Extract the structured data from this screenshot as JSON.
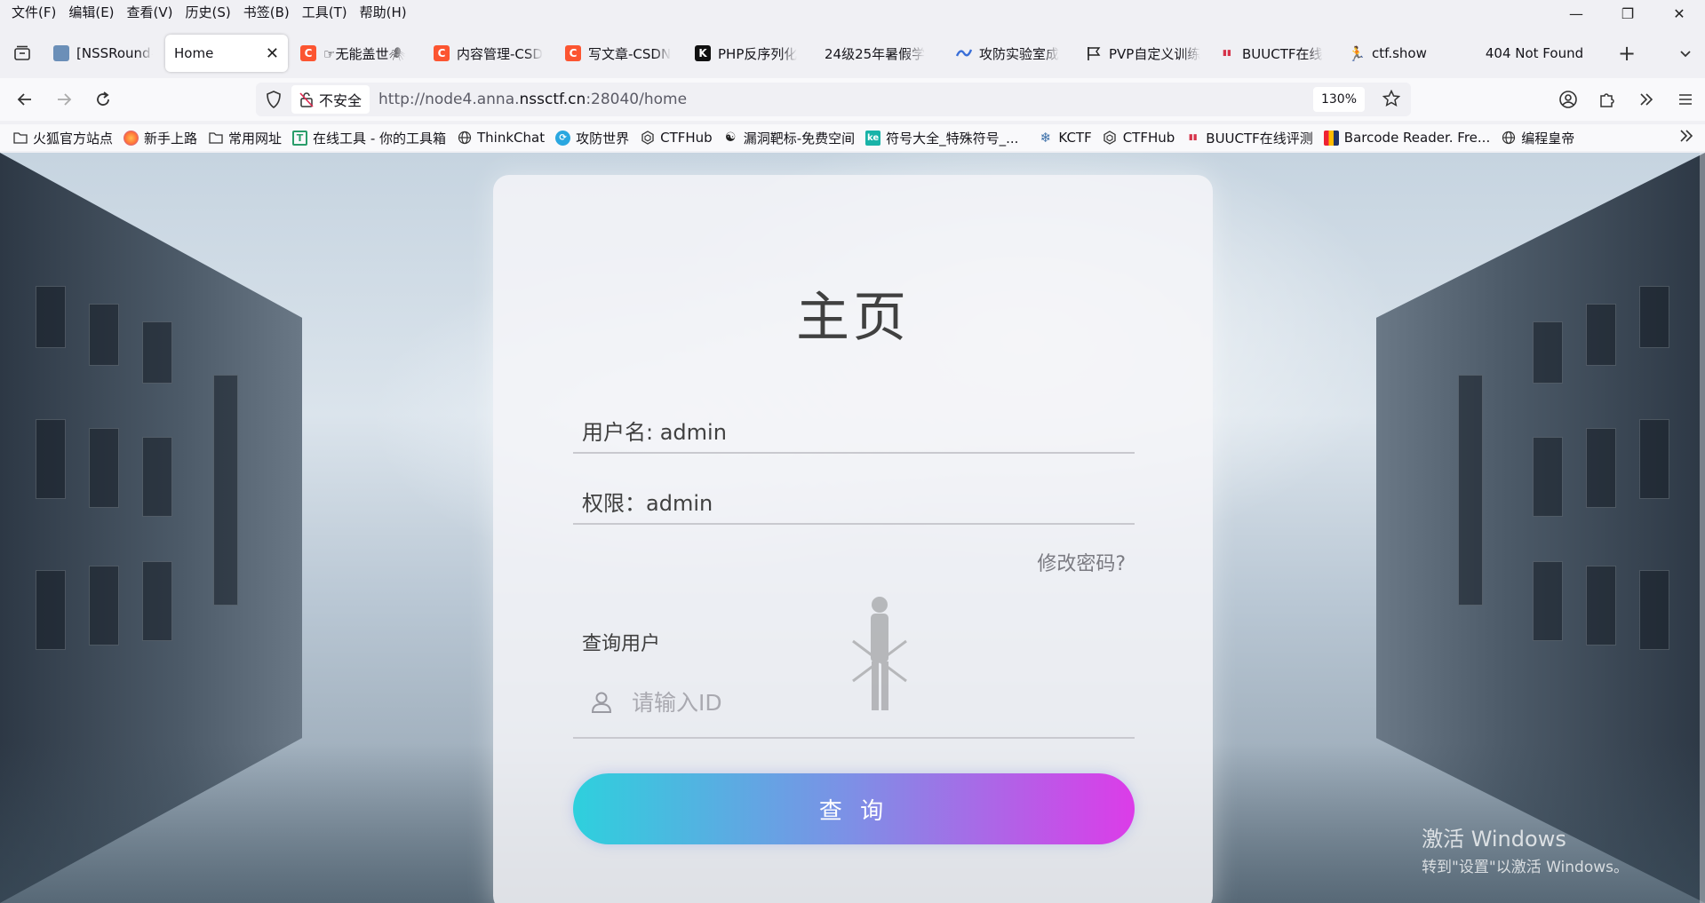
{
  "menu": [
    "文件(F)",
    "编辑(E)",
    "查看(V)",
    "历史(S)",
    "书签(B)",
    "工具(T)",
    "帮助(H)"
  ],
  "window_controls": {
    "minimize": "—",
    "restore": "❐",
    "close": "✕"
  },
  "tabs": [
    {
      "label": "[NSSRound#",
      "icon": "nss-icon",
      "color": "#6b8fb8",
      "glyph": ""
    },
    {
      "label": "Home",
      "icon": "page-icon",
      "active": true
    },
    {
      "label": "☞无能盖世🕷",
      "icon": "csdn-icon",
      "color": "#fc5531",
      "glyph": "C"
    },
    {
      "label": "内容管理-CSD",
      "icon": "csdn-icon",
      "color": "#fc5531",
      "glyph": "C"
    },
    {
      "label": "写文章-CSDN",
      "icon": "csdn-icon",
      "color": "#fc5531",
      "glyph": "C"
    },
    {
      "label": "PHP反序列化",
      "icon": "k-icon",
      "color": "#111111",
      "glyph": "K"
    },
    {
      "label": "24级25年暑假学",
      "icon": "",
      "color": "",
      "glyph": ""
    },
    {
      "label": "攻防实验室成",
      "icon": "lab-icon",
      "color": "#3a6fd8",
      "glyph": ""
    },
    {
      "label": "PVP自定义训练",
      "icon": "flag-icon",
      "color": "",
      "glyph": ""
    },
    {
      "label": "BUUCTF在线",
      "icon": "buuctf-icon",
      "color": "#d6334a",
      "glyph": ""
    },
    {
      "label": "ctf.show",
      "icon": "runner-icon",
      "color": "",
      "glyph": ""
    },
    {
      "label": "404 Not Found",
      "icon": "",
      "color": "",
      "glyph": ""
    }
  ],
  "navbar": {
    "security_label": "不安全",
    "url_prefix": "http://node4.anna.",
    "url_host": "nssctf.cn",
    "url_suffix": ":28040/home",
    "zoom": "130%"
  },
  "bookmarks": [
    {
      "label": "火狐官方站点",
      "icon": "folder-icon"
    },
    {
      "label": "新手上路",
      "icon": "firefox-icon"
    },
    {
      "label": "常用网址",
      "icon": "folder-icon"
    },
    {
      "label": "在线工具 - 你的工具箱",
      "icon": "tool-icon"
    },
    {
      "label": "ThinkChat",
      "icon": "globe-icon"
    },
    {
      "label": "攻防世界",
      "icon": "adworld-icon"
    },
    {
      "label": "CTFHub",
      "icon": "ctfhub-icon"
    },
    {
      "label": "漏洞靶标-免费空间",
      "icon": "vuln-icon"
    },
    {
      "label": "符号大全_特殊符号_...",
      "icon": "ke-icon"
    },
    {
      "label": "KCTF",
      "icon": "snowflake-icon"
    },
    {
      "label": "CTFHub",
      "icon": "ctfhub-icon"
    },
    {
      "label": "BUUCTF在线评测",
      "icon": "buuctf-icon"
    },
    {
      "label": "Barcode Reader. Fre...",
      "icon": "barcode-icon"
    },
    {
      "label": "编程皇帝",
      "icon": "globe-icon"
    }
  ],
  "page": {
    "title": "主页",
    "username": "用户名: admin",
    "permission": "权限：admin",
    "change_password": "修改密码?",
    "query_label": "查询用户",
    "id_placeholder": "请输入ID",
    "query_button": "查 询"
  },
  "watermark": {
    "line1": "激活 Windows",
    "line2": "转到\"设置\"以激活 Windows。"
  }
}
